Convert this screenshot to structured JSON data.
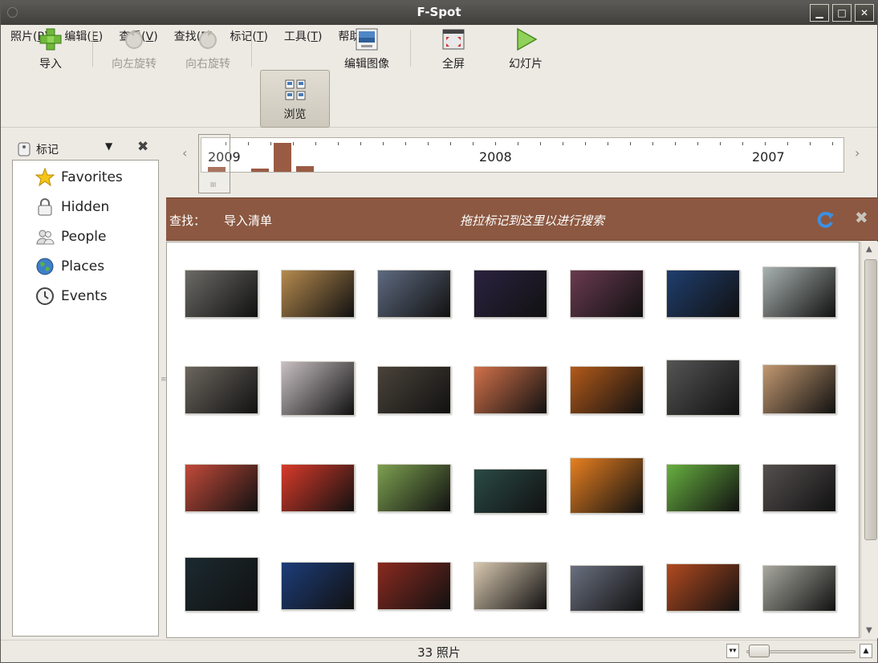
{
  "window": {
    "title": "F-Spot"
  },
  "menu": [
    {
      "label": "照片(",
      "key": "P",
      "end": ")"
    },
    {
      "label": "编辑(",
      "key": "E",
      "end": ")"
    },
    {
      "label": "查看(",
      "key": "V",
      "end": ")"
    },
    {
      "label": "查找(",
      "key": "D",
      "end": ")"
    },
    {
      "label": "标记(",
      "key": "T",
      "end": ")"
    },
    {
      "label": "工具(",
      "key": "T",
      "end": ")"
    },
    {
      "label": "帮助(",
      "key": "H",
      "end": ")"
    }
  ],
  "toolbar": {
    "import": "导入",
    "rotate_left": "向左旋转",
    "rotate_right": "向右旋转",
    "browse": "浏览",
    "edit_image": "编辑图像",
    "fullscreen": "全屏",
    "slideshow": "幻灯片"
  },
  "sidebar": {
    "header": "标记",
    "items": [
      {
        "label": "Favorites",
        "icon": "star-icon"
      },
      {
        "label": "Hidden",
        "icon": "lock-icon"
      },
      {
        "label": "People",
        "icon": "people-icon"
      },
      {
        "label": "Places",
        "icon": "globe-icon"
      },
      {
        "label": "Events",
        "icon": "clock-icon"
      }
    ]
  },
  "timeline": {
    "years": [
      "2009",
      "2008",
      "2007"
    ]
  },
  "find": {
    "label": "查找：",
    "query": "导入清单",
    "hint": "拖拉标记到这里以进行搜索"
  },
  "photos": [
    "#6b6a66",
    "#b58a4e",
    "#5e6a80",
    "#2a2240",
    "#6a3a50",
    "#1f3e6e",
    "#a9b2b0",
    "#6b665e",
    "#c8c0c2",
    "#4a433a",
    "#d1714a",
    "#b35a1a",
    "#555555",
    "#c29870",
    "#c24a3a",
    "#d83a2a",
    "#7da050",
    "#2a4a46",
    "#e88020",
    "#67b040",
    "#555050",
    "#1b2a30",
    "#1d3d7a",
    "#8a2a20",
    "#d8c8b0",
    "#6a7080",
    "#b24a20",
    "#a8a8a0"
  ],
  "status": {
    "count": "33 照片"
  },
  "colors": {
    "find_bar": "#8c5841",
    "timeline_bar": "#9a5b44",
    "titlebar": "#4a4945"
  }
}
